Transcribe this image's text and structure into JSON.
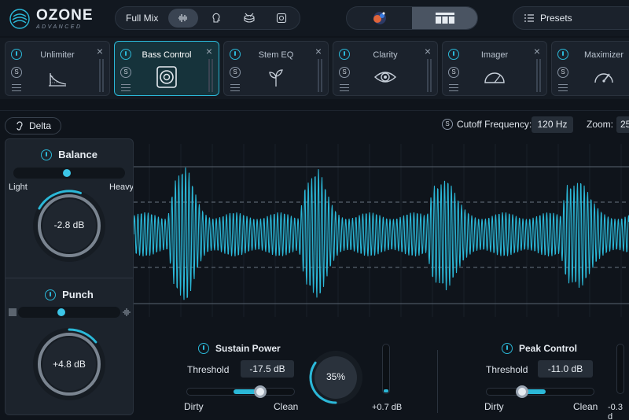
{
  "app": {
    "logo_title": "OZONE",
    "logo_subtitle": "ADVANCED"
  },
  "topbar": {
    "mix_label": "Full Mix",
    "mix_buttons": [
      "waveform-icon",
      "vocal-head-icon",
      "drum-icon",
      "speaker-icon"
    ],
    "active_mix_button": 0,
    "presets_label": "Presets"
  },
  "modules": [
    {
      "name": "Unlimiter",
      "icon": "ramp-icon",
      "active": false
    },
    {
      "name": "Bass Control",
      "icon": "subwoofer-icon",
      "active": true
    },
    {
      "name": "Stem EQ",
      "icon": "sprout-icon",
      "active": false
    },
    {
      "name": "Clarity",
      "icon": "eye-icon",
      "active": false
    },
    {
      "name": "Imager",
      "icon": "semicircle-icon",
      "active": false
    },
    {
      "name": "Maximizer",
      "icon": "gauge-icon",
      "active": false
    }
  ],
  "module_solo_glyph": "S",
  "subbar": {
    "delta_label": "Delta",
    "cutoff_label": "Cutoff Frequency:",
    "cutoff_value": "120 Hz",
    "zoom_label": "Zoom:",
    "zoom_value": "25"
  },
  "balance": {
    "title": "Balance",
    "left_label": "Light",
    "right_label": "Heavy",
    "value": "-2.8 dB",
    "slider_position": 0.48,
    "knob_fraction": 0.22
  },
  "punch": {
    "title": "Punch",
    "value": "+4.8 dB",
    "slider_position": 0.42,
    "knob_fraction": 0.14
  },
  "sustain": {
    "title": "Sustain Power",
    "threshold_label": "Threshold",
    "threshold_value": "-17.5 dB",
    "left_label": "Dirty",
    "right_label": "Clean",
    "slider_position": 0.7,
    "mix_value": "35%",
    "mix_fraction": 0.35,
    "meter_value": "+0.7 dB",
    "meter_level": 0.06
  },
  "peak": {
    "title": "Peak Control",
    "threshold_label": "Threshold",
    "threshold_value": "-11.0 dB",
    "left_label": "Dirty",
    "right_label": "Clean",
    "slider_position": 0.3,
    "meter_value": "-0.3 d"
  },
  "colors": {
    "accent": "#2bb8d8",
    "background": "#0f141b",
    "panel": "#1c232c"
  }
}
